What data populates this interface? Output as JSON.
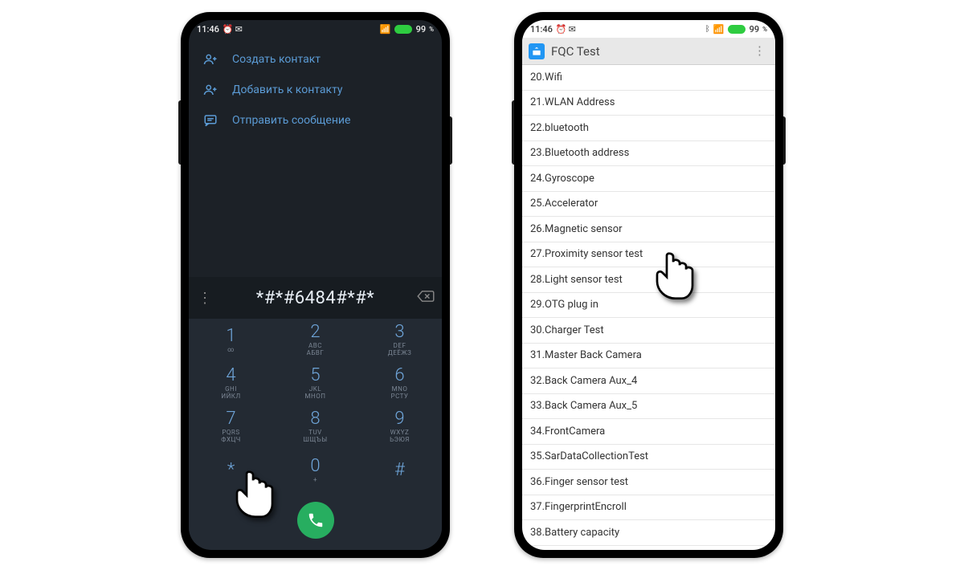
{
  "status": {
    "time": "11:46",
    "battery_pct": "99",
    "battery_unit": "%"
  },
  "dialer": {
    "menu": [
      {
        "label": "Создать контакт"
      },
      {
        "label": "Добавить к контакту"
      },
      {
        "label": "Отправить сообщение"
      }
    ],
    "entered": "*#*#6484#*#*",
    "keys": [
      {
        "digit": "1",
        "letters": "∞"
      },
      {
        "digit": "2",
        "letters": "ABC\nАБВГ"
      },
      {
        "digit": "3",
        "letters": "DEF\nДЕЁЖЗ"
      },
      {
        "digit": "4",
        "letters": "GHI\nИЙКЛ"
      },
      {
        "digit": "5",
        "letters": "JKL\nМНОП"
      },
      {
        "digit": "6",
        "letters": "MNO\nРСТУ"
      },
      {
        "digit": "7",
        "letters": "PQRS\nФХЦЧ"
      },
      {
        "digit": "8",
        "letters": "TUV\nШЩЪЫ"
      },
      {
        "digit": "9",
        "letters": "WXYZ\nЬЭЮЯ"
      },
      {
        "digit": "*",
        "letters": ""
      },
      {
        "digit": "0",
        "letters": "+"
      },
      {
        "digit": "#",
        "letters": ""
      }
    ]
  },
  "fqc": {
    "title": "FQC Test",
    "items": [
      "20.Wifi",
      "21.WLAN Address",
      "22.bluetooth",
      "23.Bluetooth address",
      "24.Gyroscope",
      "25.Accelerator",
      "26.Magnetic sensor",
      "27.Proximity sensor test",
      "28.Light sensor test",
      "29.OTG plug in",
      "30.Charger Test",
      "31.Master Back Camera",
      "32.Back Camera Aux_4",
      "33.Back Camera Aux_5",
      "34.FrontCamera",
      "35.SarDataCollectionTest",
      "36.Finger sensor test",
      "37.FingerprintEncroll",
      "38.Battery capacity"
    ]
  }
}
